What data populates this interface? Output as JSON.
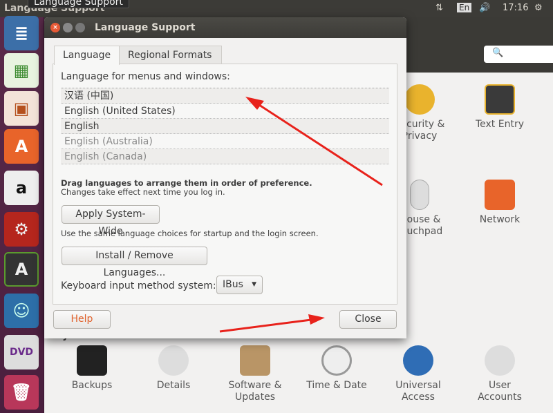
{
  "topbar": {
    "app_title": "Language Support",
    "tooltip": "Language Support",
    "keyboard": "En",
    "time": "17:16"
  },
  "launcher": {
    "items": [
      "LibreOffice Writer",
      "LibreOffice Calc",
      "LibreOffice Impress",
      "Ubuntu Software Center",
      "Amazon",
      "System Settings",
      "Software Updater",
      "Language Support",
      "DVD",
      "Trash"
    ]
  },
  "settings": {
    "search_placeholder": "",
    "items": [
      {
        "label": "Security &\nPrivacy",
        "icon": "security-icon"
      },
      {
        "label": "Text Entry",
        "icon": "text-entry-icon"
      },
      {
        "label": "Mouse &\nTouchpad",
        "icon": "mouse-icon"
      },
      {
        "label": "Network",
        "icon": "network-icon"
      }
    ],
    "section": "System",
    "system_items": [
      {
        "label": "Backups",
        "icon": "safe-icon"
      },
      {
        "label": "Details",
        "icon": "gear-icon"
      },
      {
        "label": "Software &\nUpdates",
        "icon": "package-icon"
      },
      {
        "label": "Time & Date",
        "icon": "clock-icon"
      },
      {
        "label": "Universal\nAccess",
        "icon": "accessibility-icon"
      },
      {
        "label": "User\nAccounts",
        "icon": "users-icon"
      }
    ]
  },
  "dialog": {
    "title": "Language Support",
    "tabs": [
      "Language",
      "Regional Formats"
    ],
    "menus_label": "Language for menus and windows:",
    "languages": [
      "汉语 (中国)",
      "English (United States)",
      "English",
      "English (Australia)",
      "English (Canada)"
    ],
    "drag_hint": "Drag languages to arrange them in order of preference.",
    "drag_sub": "Changes take effect next time you log in.",
    "apply_btn": "Apply System-Wide",
    "apply_hint": "Use the same language choices for startup and the login screen.",
    "install_btn": "Install / Remove Languages...",
    "input_label": "Keyboard input method system:",
    "input_value": "IBus",
    "help_btn": "Help",
    "close_btn": "Close"
  },
  "annotation_color": "#e8221b"
}
